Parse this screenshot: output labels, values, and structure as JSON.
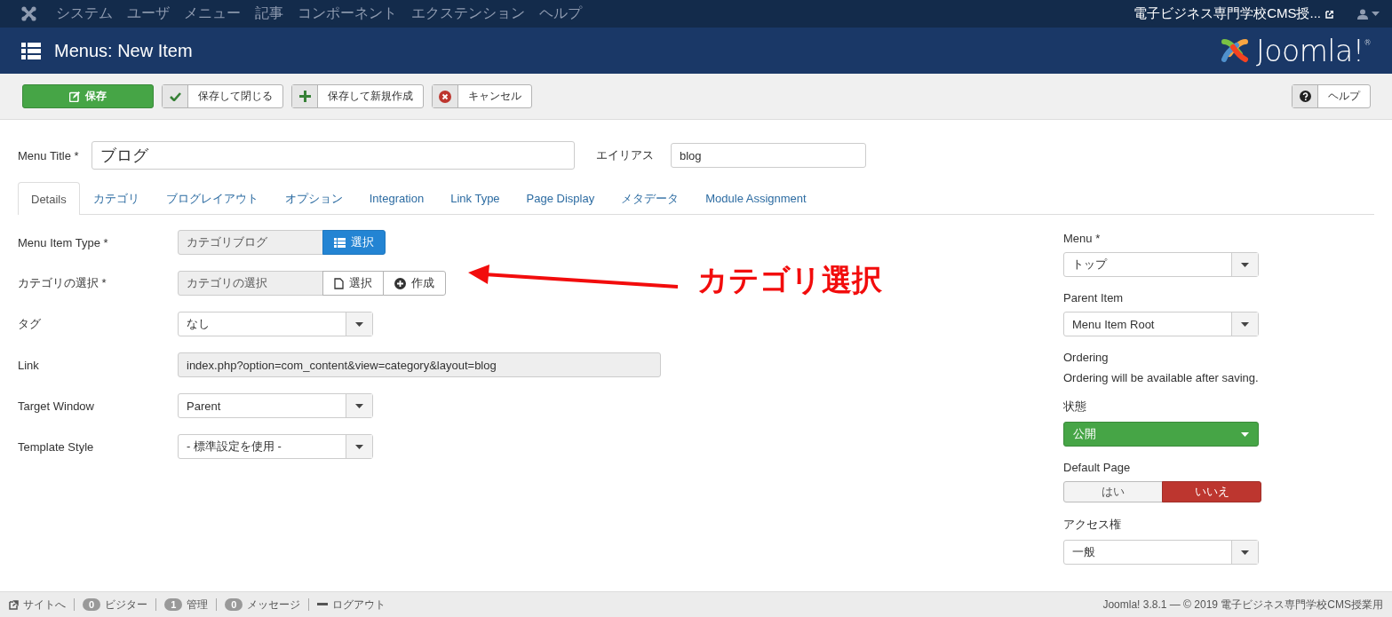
{
  "topnav": {
    "menu": [
      "システム",
      "ユーザ",
      "メニュー",
      "記事",
      "コンポーネント",
      "エクステンション",
      "ヘルプ"
    ],
    "site_link": "電子ビジネス専門学校CMS授..."
  },
  "header": {
    "title": "Menus: New Item",
    "logo_text": "Joomla!",
    "logo_mark": "®"
  },
  "toolbar": {
    "buttons": [
      {
        "label": "保存",
        "kind": "save"
      },
      {
        "label": "保存して閉じる",
        "kind": "check"
      },
      {
        "label": "保存して新規作成",
        "kind": "plus"
      },
      {
        "label": "キャンセル",
        "kind": "cancel"
      }
    ],
    "help": "ヘルプ"
  },
  "title_field": {
    "label": "Menu Title *",
    "value": "ブログ"
  },
  "alias_field": {
    "label": "エイリアス",
    "value": "blog"
  },
  "tabs": [
    {
      "label": "Details",
      "selected": true
    },
    {
      "label": "カテゴリ",
      "selected": false
    },
    {
      "label": "ブログレイアウト",
      "selected": false
    },
    {
      "label": "オプション",
      "selected": false
    },
    {
      "label": "Integration",
      "selected": false
    },
    {
      "label": "Link Type",
      "selected": false
    },
    {
      "label": "Page Display",
      "selected": false
    },
    {
      "label": "メタデータ",
      "selected": false
    },
    {
      "label": "Module Assignment",
      "selected": false
    }
  ],
  "fields": [
    {
      "label": "Menu Item Type *",
      "kind": "picker",
      "value": "カテゴリブログ",
      "buttons": [
        {
          "label": "選択",
          "kind": "list"
        }
      ]
    },
    {
      "label": "カテゴリの選択 *",
      "kind": "picker",
      "value": "カテゴリの選択",
      "buttons": [
        {
          "label": "選択",
          "kind": "file"
        },
        {
          "label": "作成",
          "kind": "create"
        }
      ]
    },
    {
      "label": "タグ",
      "kind": "select",
      "value": "なし"
    },
    {
      "label": "Link",
      "kind": "readonly",
      "value": "index.php?option=com_content&view=category&layout=blog"
    },
    {
      "label": "Target Window",
      "kind": "select",
      "value": "Parent"
    },
    {
      "label": "Template Style",
      "kind": "select",
      "value": "- 標準設定を使用 -"
    }
  ],
  "side": [
    {
      "label": "Menu *",
      "kind": "select",
      "value": "トップ"
    },
    {
      "label": "Parent Item",
      "kind": "select",
      "value": "Menu Item Root"
    },
    {
      "label": "Ordering",
      "kind": "note",
      "value": "Ordering will be available after saving."
    },
    {
      "label": "状態",
      "kind": "status",
      "value": "公開"
    },
    {
      "label": "Default Page",
      "kind": "toggle",
      "options": [
        {
          "label": "はい",
          "selected": false
        },
        {
          "label": "いいえ",
          "selected": true
        }
      ]
    },
    {
      "label": "アクセス権",
      "kind": "select",
      "value": "一般"
    }
  ],
  "annotation": {
    "text": "カテゴリ選択"
  },
  "status_bar": {
    "items": [
      {
        "kind": "site",
        "label": "サイトへ"
      },
      {
        "kind": "count",
        "count": "0",
        "label": "ビジター"
      },
      {
        "kind": "count",
        "count": "1",
        "label": "管理"
      },
      {
        "kind": "count",
        "count": "0",
        "label": "メッセージ"
      },
      {
        "kind": "logout",
        "label": "ログアウト"
      }
    ],
    "footer": "Joomla! 3.8.1 — © 2019 電子ビジネス専門学校CMS授業用"
  }
}
